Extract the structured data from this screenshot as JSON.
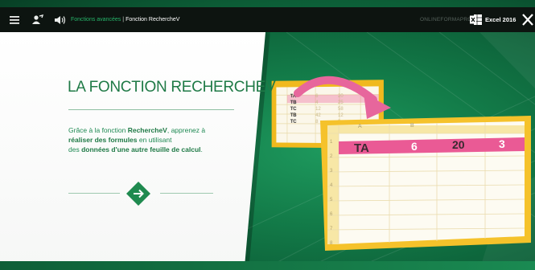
{
  "topbar": {
    "section": "Fonctions avancées",
    "separator": "|",
    "current": "Fonction RechercheV",
    "brand": "ONLINEFORMAPRO",
    "app": "Excel 2016"
  },
  "icons": [
    "menu-icon",
    "user-share-icon",
    "audio-icon",
    "excel-icon",
    "close-icon",
    "arrow-right-icon",
    "curved-arrow-icon"
  ],
  "slide": {
    "title": "LA FONCTION RECHERCHEV",
    "desc_1": "Grâce à la fonction ",
    "desc_2": "RechercheV",
    "desc_3": ", apprenez à",
    "desc_4": "réaliser des formules",
    "desc_5": " en utilisant",
    "desc_6": "des ",
    "desc_7": "données d'une autre feuille de calcul",
    "desc_8": "."
  },
  "small_sheet": {
    "rows": [
      [
        "TA",
        "6",
        "20"
      ],
      [
        "TB",
        "4",
        "25"
      ],
      [
        "TC",
        "12",
        "58"
      ],
      [
        "TB",
        "42",
        "12"
      ],
      [
        "TC",
        "8",
        "9"
      ]
    ]
  },
  "big_sheet": {
    "col_headers": [
      "A",
      "B"
    ],
    "row_numbers": [
      "1",
      "2",
      "3",
      "4",
      "5",
      "6",
      "7",
      "8"
    ],
    "highlight_row": [
      "TA",
      "6",
      "20",
      "3"
    ]
  },
  "colors": {
    "accent_green": "#1f7a46",
    "bg_green": "#137c49",
    "sheet_frame": "#f5c22b",
    "highlight_pink": "#ea5a95",
    "topbar": "#0d1410"
  }
}
